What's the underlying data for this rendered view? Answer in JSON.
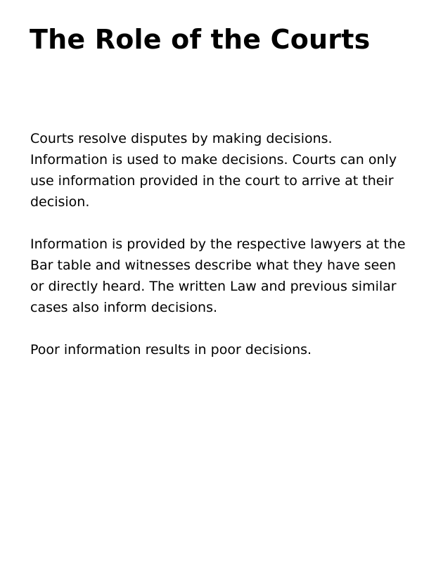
{
  "document": {
    "title": "The Role of the Courts",
    "paragraphs": [
      "Courts resolve disputes by making decisions. Information is used to make decisions. Courts can only use information provided in the court to arrive at their decision.",
      "Information is provided by the respective lawyers at the Bar table and witnesses describe what they have seen or directly heard. The written Law and previous similar cases also inform decisions.",
      "Poor information results in poor decisions."
    ]
  }
}
